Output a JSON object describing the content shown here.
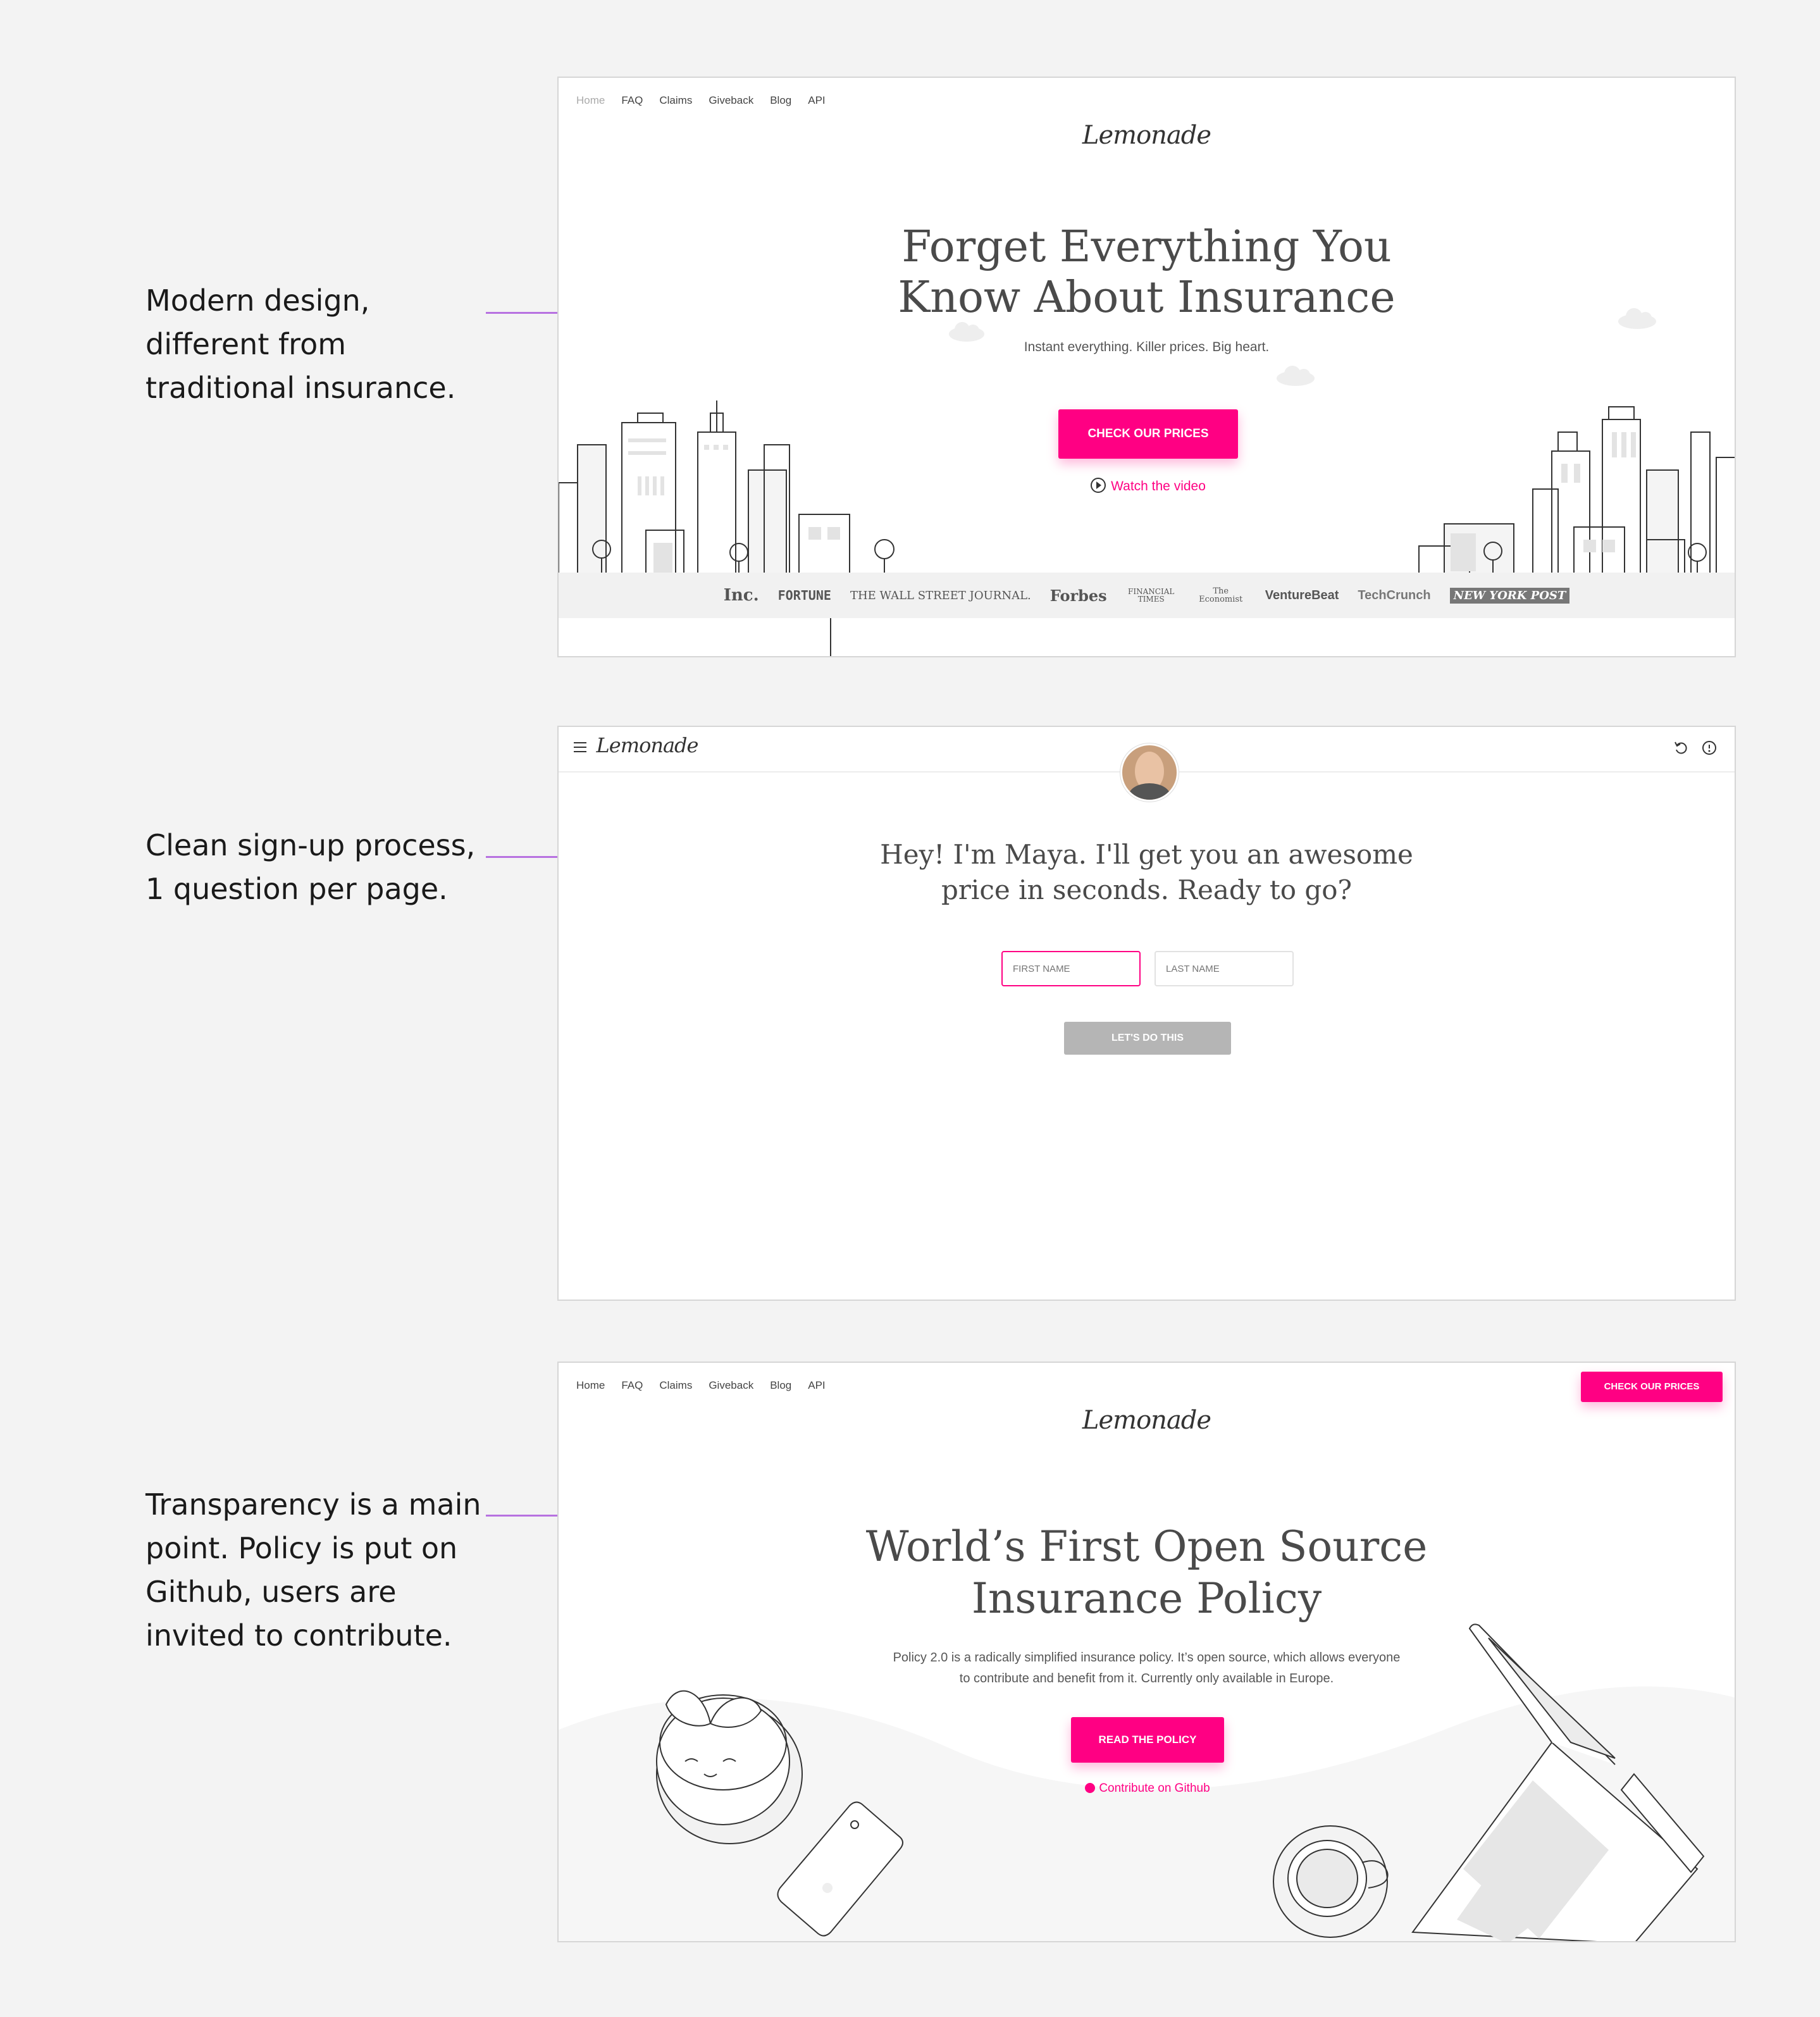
{
  "annotations": [
    {
      "lines": [
        "Modern design,",
        "different from",
        "traditional insurance."
      ]
    },
    {
      "lines": [
        "Clean sign-up process,",
        "1 question per page."
      ]
    },
    {
      "lines": [
        "Transparency is a main",
        "point. Policy is put on",
        "Github, users are",
        "invited to contribute."
      ]
    }
  ],
  "brand": {
    "logo": "Lemonade",
    "accent_color": "#ff0083",
    "connector_color": "#b771e0"
  },
  "panel_home": {
    "nav": [
      "Home",
      "FAQ",
      "Claims",
      "Giveback",
      "Blog",
      "API"
    ],
    "title_lines": [
      "Forget Everything You",
      "Know About Insurance"
    ],
    "subtitle": "Instant everything. Killer prices. Big heart.",
    "cta": "CHECK OUR PRICES",
    "video_link": "Watch the video",
    "press": [
      "Inc.",
      "FORTUNE",
      "THE WALL STREET JOURNAL.",
      "Forbes",
      "FINANCIAL TIMES",
      "The Economist",
      "VentureBeat",
      "TechCrunch",
      "NEW YORK POST"
    ]
  },
  "panel_signup": {
    "menu_icon": "hamburger-icon",
    "title_lines": [
      "Hey! I'm Maya. I'll get you an awesome",
      "price in seconds. Ready to go?"
    ],
    "first_name_placeholder": "FIRST NAME",
    "last_name_placeholder": "LAST NAME",
    "submit": "LET'S DO THIS",
    "icons": [
      "undo-icon",
      "help-icon"
    ]
  },
  "panel_policy": {
    "nav": [
      "Home",
      "FAQ",
      "Claims",
      "Giveback",
      "Blog",
      "API"
    ],
    "top_cta": "CHECK OUR PRICES",
    "title_lines": [
      "World’s First Open Source",
      "Insurance Policy"
    ],
    "body_lines": [
      "Policy 2.0 is a radically simplified insurance policy. It’s open source, which allows everyone",
      "to contribute and benefit from it. Currently only available in Europe."
    ],
    "cta": "READ THE POLICY",
    "github_link": "Contribute on Github"
  }
}
